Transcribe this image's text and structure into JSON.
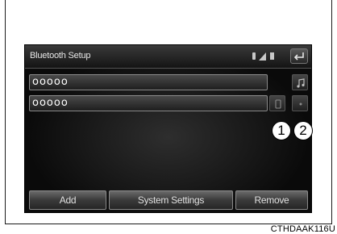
{
  "screen": {
    "title": "Bluetooth Setup",
    "status_icons": [
      "bluetooth-icon",
      "signal-icon",
      "battery-icon"
    ],
    "back_icon": "back-arrow-icon"
  },
  "devices": [
    {
      "label": "ooooo",
      "actions": []
    },
    {
      "label": "ooooo",
      "actions": [
        "connection-icon",
        "info-icon"
      ]
    }
  ],
  "side_buttons": {
    "top_icon": "music-note-icon"
  },
  "callouts": [
    "1",
    "2"
  ],
  "bottom_bar": {
    "add": "Add",
    "system_settings": "System Settings",
    "remove": "Remove"
  },
  "caption": "CTHDAAK116U",
  "colors": {
    "screen_bg": "#0a0a0a",
    "text": "#ffffff",
    "button_border": "#8a8a8a"
  }
}
